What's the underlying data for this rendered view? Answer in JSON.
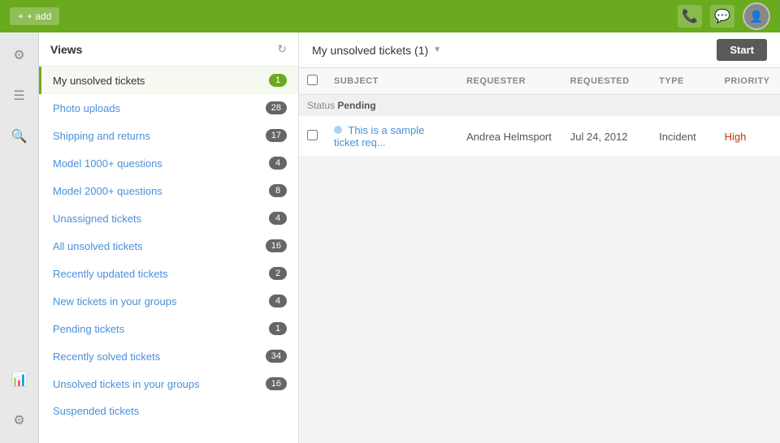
{
  "topbar": {
    "add_label": "+ add",
    "phone_icon": "📞",
    "chat_icon": "💬",
    "avatar_icon": "👤"
  },
  "icon_sidebar": {
    "gear_icon": "⚙",
    "menu_icon": "☰",
    "search_icon": "🔍",
    "chart_icon": "📊",
    "settings_icon": "⚙"
  },
  "views": {
    "title": "Views",
    "items": [
      {
        "label": "My unsolved tickets",
        "count": "1",
        "active": true
      },
      {
        "label": "Photo uploads",
        "count": "28",
        "active": false
      },
      {
        "label": "Shipping and returns",
        "count": "17",
        "active": false
      },
      {
        "label": "Model 1000+ questions",
        "count": "4",
        "active": false
      },
      {
        "label": "Model 2000+ questions",
        "count": "8",
        "active": false
      },
      {
        "label": "Unassigned tickets",
        "count": "4",
        "active": false
      },
      {
        "label": "All unsolved tickets",
        "count": "16",
        "active": false
      },
      {
        "label": "Recently updated tickets",
        "count": "2",
        "active": false
      },
      {
        "label": "New tickets in your groups",
        "count": "4",
        "active": false
      },
      {
        "label": "Pending tickets",
        "count": "1",
        "active": false
      },
      {
        "label": "Recently solved tickets",
        "count": "34",
        "active": false
      },
      {
        "label": "Unsolved tickets in your groups",
        "count": "16",
        "active": false
      },
      {
        "label": "Suspended tickets",
        "count": "",
        "active": false
      }
    ]
  },
  "content": {
    "title": "My unsolved tickets (1)",
    "start_label": "Start",
    "columns": [
      "Subject",
      "Requester",
      "Requested",
      "Type",
      "Priority"
    ],
    "status_label": "Status",
    "status_value": "Pending",
    "tickets": [
      {
        "subject": "This is a sample ticket req...",
        "requester": "Andrea Helmsport",
        "requested": "Jul 24, 2012",
        "type": "Incident",
        "priority": "High"
      }
    ]
  }
}
